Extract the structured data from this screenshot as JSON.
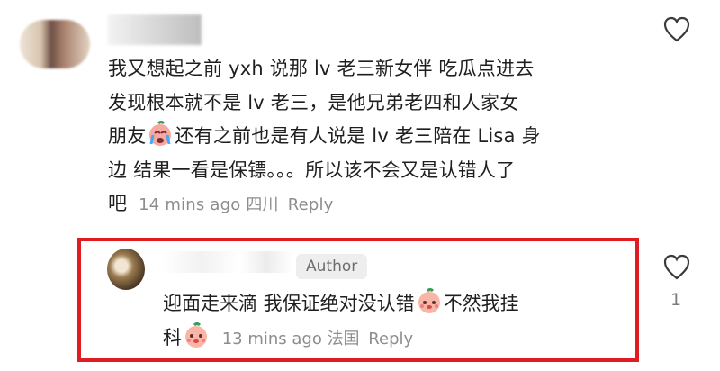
{
  "comment": {
    "lines": [
      "我又想起之前 yxh 说那 lv 老三新女伴 吃瓜点进去",
      "发现根本就不是 lv 老三，是他兄弟老四和人家女",
      "还有之前也是有人说是 lv 老三陪在 Lisa 身",
      "边  结果一看是保镖。。。所以该不会又是认错人了"
    ],
    "line3_prefix": "朋友",
    "last_word": "吧",
    "time": "14 mins ago",
    "location": "四川",
    "reply": "Reply"
  },
  "reply_comment": {
    "author_badge": "Author",
    "line1": "迎面走来滴 我保证绝对没认错",
    "line1_suffix": "不然我挂",
    "line2_prefix": "科",
    "time": "13 mins ago",
    "location": "法国",
    "reply": "Reply",
    "like_count": "1"
  },
  "icons": [
    "heart-outline-icon",
    "crying-face-emoji",
    "blush-face-emoji"
  ],
  "colors": {
    "highlight_border": "#e11b22",
    "meta_text": "#8d8d8d",
    "badge_bg": "#eeeeee"
  }
}
